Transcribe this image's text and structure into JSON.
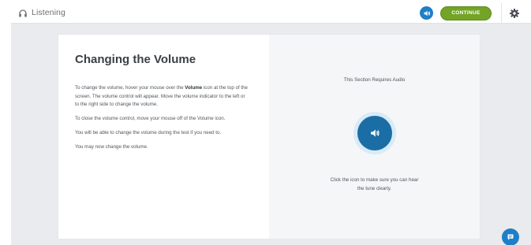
{
  "topbar": {
    "title": "Listening",
    "continue_label": "CONTINUE"
  },
  "content": {
    "heading": "Changing the Volume",
    "para1_a": "To change the volume, hover your mouse over the ",
    "para1_bold": "Volume",
    "para1_b": " icon at the top of the screen. The volume control will appear. Move the volume indicator to the left or to the right side to change the volume.",
    "para2": "To close the volume control, move your mouse off of the Volume icon.",
    "para3": "You will be able to change the volume during the test if you need to.",
    "para4": "You may now change the volume."
  },
  "audio_panel": {
    "requirement": "This Section Requires Audio",
    "hint_line1": "Click the icon to make sure you can hear",
    "hint_line2": "the tune clearly."
  },
  "icons": {
    "headphones": "headphones-icon",
    "volume": "speaker-icon",
    "settings": "gear-icon",
    "play": "speaker-icon",
    "chat": "chat-icon"
  },
  "colors": {
    "accent_blue": "#1e7fc7",
    "play_blue": "#1a6ea5",
    "continue_green": "#73a427",
    "background": "#e9ebee"
  }
}
